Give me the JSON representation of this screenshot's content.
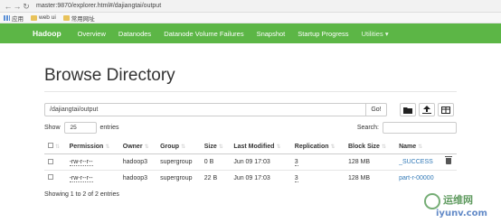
{
  "browser": {
    "url": "master:9870/explorer.html#/dajiangtai/output",
    "bookmarks": [
      "应用",
      "web ui",
      "常用网址"
    ]
  },
  "navbar": {
    "brand": "Hadoop",
    "items": [
      "Overview",
      "Datanodes",
      "Datanode Volume Failures",
      "Snapshot",
      "Startup Progress",
      "Utilities ▾"
    ]
  },
  "page": {
    "title": "Browse Directory",
    "path_value": "/dajiangtai/output",
    "go_label": "Go!",
    "show_label": "Show",
    "page_size": "25",
    "entries_label": "entries",
    "search_label": "Search:"
  },
  "table": {
    "headers": [
      "Permission",
      "Owner",
      "Group",
      "Size",
      "Last Modified",
      "Replication",
      "Block Size",
      "Name"
    ],
    "rows": [
      {
        "permission": "-rw-r--r--",
        "owner": "hadoop3",
        "group": "supergroup",
        "size": "0 B",
        "modified": "Jun 09 17:03",
        "replication": "3",
        "block": "128 MB",
        "name": "_SUCCESS"
      },
      {
        "permission": "-rw-r--r--",
        "owner": "hadoop3",
        "group": "supergroup",
        "size": "22 B",
        "modified": "Jun 09 17:03",
        "replication": "3",
        "block": "128 MB",
        "name": "part-r-00000"
      }
    ]
  },
  "footer": {
    "showing": "Showing 1 to 2 of 2 entries"
  },
  "watermark": {
    "line1": "运维网",
    "line2": "iyunv.com"
  },
  "colors": {
    "navbar": "#5cb646",
    "link": "#337ab7"
  }
}
